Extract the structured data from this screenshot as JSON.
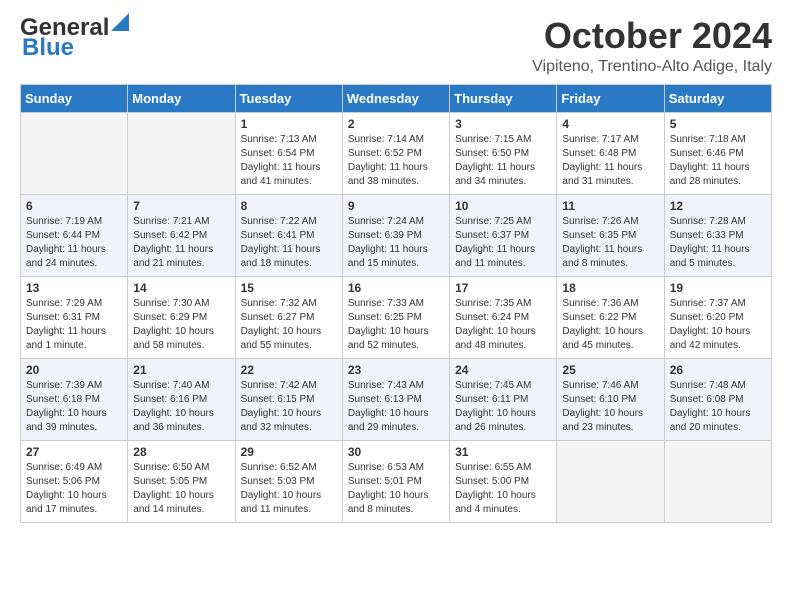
{
  "header": {
    "logo_general": "General",
    "logo_blue": "Blue",
    "month": "October 2024",
    "location": "Vipiteno, Trentino-Alto Adige, Italy"
  },
  "days_of_week": [
    "Sunday",
    "Monday",
    "Tuesday",
    "Wednesday",
    "Thursday",
    "Friday",
    "Saturday"
  ],
  "weeks": [
    [
      {
        "day": "",
        "empty": true
      },
      {
        "day": "",
        "empty": true
      },
      {
        "day": "1",
        "sunrise": "7:13 AM",
        "sunset": "6:54 PM",
        "daylight": "11 hours and 41 minutes."
      },
      {
        "day": "2",
        "sunrise": "7:14 AM",
        "sunset": "6:52 PM",
        "daylight": "11 hours and 38 minutes."
      },
      {
        "day": "3",
        "sunrise": "7:15 AM",
        "sunset": "6:50 PM",
        "daylight": "11 hours and 34 minutes."
      },
      {
        "day": "4",
        "sunrise": "7:17 AM",
        "sunset": "6:48 PM",
        "daylight": "11 hours and 31 minutes."
      },
      {
        "day": "5",
        "sunrise": "7:18 AM",
        "sunset": "6:46 PM",
        "daylight": "11 hours and 28 minutes."
      }
    ],
    [
      {
        "day": "6",
        "sunrise": "7:19 AM",
        "sunset": "6:44 PM",
        "daylight": "11 hours and 24 minutes."
      },
      {
        "day": "7",
        "sunrise": "7:21 AM",
        "sunset": "6:42 PM",
        "daylight": "11 hours and 21 minutes."
      },
      {
        "day": "8",
        "sunrise": "7:22 AM",
        "sunset": "6:41 PM",
        "daylight": "11 hours and 18 minutes."
      },
      {
        "day": "9",
        "sunrise": "7:24 AM",
        "sunset": "6:39 PM",
        "daylight": "11 hours and 15 minutes."
      },
      {
        "day": "10",
        "sunrise": "7:25 AM",
        "sunset": "6:37 PM",
        "daylight": "11 hours and 11 minutes."
      },
      {
        "day": "11",
        "sunrise": "7:26 AM",
        "sunset": "6:35 PM",
        "daylight": "11 hours and 8 minutes."
      },
      {
        "day": "12",
        "sunrise": "7:28 AM",
        "sunset": "6:33 PM",
        "daylight": "11 hours and 5 minutes."
      }
    ],
    [
      {
        "day": "13",
        "sunrise": "7:29 AM",
        "sunset": "6:31 PM",
        "daylight": "11 hours and 1 minute."
      },
      {
        "day": "14",
        "sunrise": "7:30 AM",
        "sunset": "6:29 PM",
        "daylight": "10 hours and 58 minutes."
      },
      {
        "day": "15",
        "sunrise": "7:32 AM",
        "sunset": "6:27 PM",
        "daylight": "10 hours and 55 minutes."
      },
      {
        "day": "16",
        "sunrise": "7:33 AM",
        "sunset": "6:25 PM",
        "daylight": "10 hours and 52 minutes."
      },
      {
        "day": "17",
        "sunrise": "7:35 AM",
        "sunset": "6:24 PM",
        "daylight": "10 hours and 48 minutes."
      },
      {
        "day": "18",
        "sunrise": "7:36 AM",
        "sunset": "6:22 PM",
        "daylight": "10 hours and 45 minutes."
      },
      {
        "day": "19",
        "sunrise": "7:37 AM",
        "sunset": "6:20 PM",
        "daylight": "10 hours and 42 minutes."
      }
    ],
    [
      {
        "day": "20",
        "sunrise": "7:39 AM",
        "sunset": "6:18 PM",
        "daylight": "10 hours and 39 minutes."
      },
      {
        "day": "21",
        "sunrise": "7:40 AM",
        "sunset": "6:16 PM",
        "daylight": "10 hours and 36 minutes."
      },
      {
        "day": "22",
        "sunrise": "7:42 AM",
        "sunset": "6:15 PM",
        "daylight": "10 hours and 32 minutes."
      },
      {
        "day": "23",
        "sunrise": "7:43 AM",
        "sunset": "6:13 PM",
        "daylight": "10 hours and 29 minutes."
      },
      {
        "day": "24",
        "sunrise": "7:45 AM",
        "sunset": "6:11 PM",
        "daylight": "10 hours and 26 minutes."
      },
      {
        "day": "25",
        "sunrise": "7:46 AM",
        "sunset": "6:10 PM",
        "daylight": "10 hours and 23 minutes."
      },
      {
        "day": "26",
        "sunrise": "7:48 AM",
        "sunset": "6:08 PM",
        "daylight": "10 hours and 20 minutes."
      }
    ],
    [
      {
        "day": "27",
        "sunrise": "6:49 AM",
        "sunset": "5:06 PM",
        "daylight": "10 hours and 17 minutes."
      },
      {
        "day": "28",
        "sunrise": "6:50 AM",
        "sunset": "5:05 PM",
        "daylight": "10 hours and 14 minutes."
      },
      {
        "day": "29",
        "sunrise": "6:52 AM",
        "sunset": "5:03 PM",
        "daylight": "10 hours and 11 minutes."
      },
      {
        "day": "30",
        "sunrise": "6:53 AM",
        "sunset": "5:01 PM",
        "daylight": "10 hours and 8 minutes."
      },
      {
        "day": "31",
        "sunrise": "6:55 AM",
        "sunset": "5:00 PM",
        "daylight": "10 hours and 4 minutes."
      },
      {
        "day": "",
        "empty": true
      },
      {
        "day": "",
        "empty": true
      }
    ]
  ],
  "labels": {
    "sunrise": "Sunrise:",
    "sunset": "Sunset:",
    "daylight": "Daylight:"
  }
}
